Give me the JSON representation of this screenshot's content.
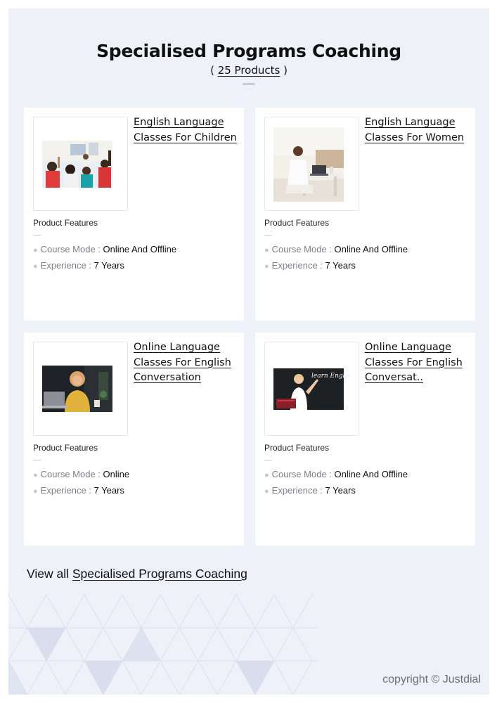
{
  "header": {
    "title": "Specialised Programs Coaching",
    "subtitle_open": "( ",
    "subtitle_count": "25 Products",
    "subtitle_close": " )"
  },
  "products": [
    {
      "title": "English Language Classes For Children",
      "features_label": "Product Features",
      "course_mode_key": "Course Mode : ",
      "course_mode": "Online And Offline",
      "experience_key": "Experience : ",
      "experience": "7 Years"
    },
    {
      "title": "English Language Classes For Women",
      "features_label": "Product Features",
      "course_mode_key": "Course Mode : ",
      "course_mode": "Online And Offline",
      "experience_key": "Experience : ",
      "experience": "7 Years"
    },
    {
      "title": "Online Language Classes For English Conversation",
      "features_label": "Product Features",
      "course_mode_key": "Course Mode : ",
      "course_mode": "Online",
      "experience_key": "Experience : ",
      "experience": "7 Years"
    },
    {
      "title": "Online Language Classes For English Conversat..",
      "features_label": "Product Features",
      "course_mode_key": "Course Mode : ",
      "course_mode": "Online And Offline",
      "experience_key": "Experience : ",
      "experience": "7 Years"
    }
  ],
  "images": {
    "img4_board_text": "learn English"
  },
  "footer": {
    "view_all_prefix": "View all ",
    "view_all_link": "Specialised Programs Coaching",
    "copyright": "copyright © Justdial"
  },
  "colors": {
    "page_background": "#eef1f8",
    "card_background": "#ffffff",
    "muted_text": "#7b7f88",
    "pattern": "#dfe4f2"
  }
}
